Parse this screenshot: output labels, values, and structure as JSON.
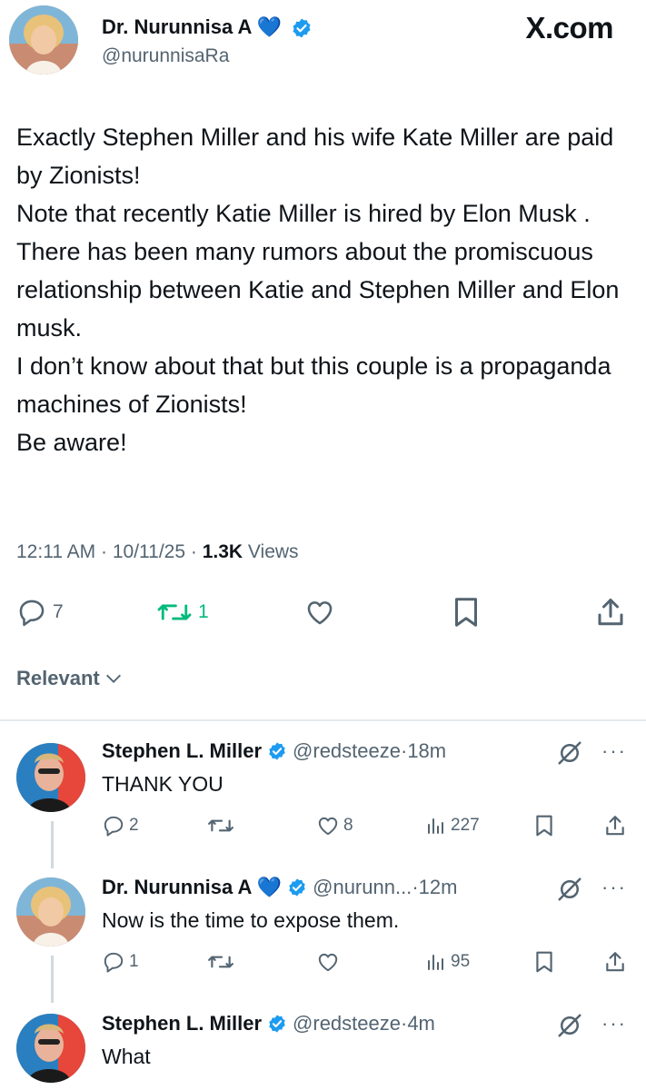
{
  "brand": "X.com",
  "post": {
    "author_name": "Dr. Nurunnisa A 💙",
    "author_handle": "@nurunnisaRa",
    "text": "Exactly Stephen Miller and his wife Kate Miller are paid by Zionists!\nNote that recently Katie Miller is hired by Elon Musk .\nThere has been many rumors about the promiscuous relationship between Katie and Stephen Miller and Elon musk.\nI don’t know about that but this couple is a propaganda machines of Zionists!\nBe aware!",
    "time": "12:11 AM",
    "date": "10/11/25",
    "views_count": "1.3K",
    "views_label": "Views",
    "replies": "7",
    "reposts": "1"
  },
  "sort_label": "Relevant",
  "replies": [
    {
      "name": "Stephen L. Miller",
      "handle": "@redsteeze",
      "age": "18m",
      "text": "THANK YOU",
      "replies": "2",
      "reposts": "",
      "likes": "8",
      "views": "227"
    },
    {
      "name": "Dr. Nurunnisa A 💙",
      "handle": "@nurunn...",
      "age": "12m",
      "text": "Now is the time to expose them.",
      "replies": "1",
      "reposts": "",
      "likes": "",
      "views": "95"
    },
    {
      "name": "Stephen L. Miller",
      "handle": "@redsteeze",
      "age": "4m",
      "text": "What"
    }
  ],
  "colors": {
    "verified": "#1d9bf0",
    "repost_active": "#00ba7c",
    "muted": "#536471"
  },
  "icons": [
    "verified-badge-icon",
    "reply-icon",
    "repost-icon",
    "like-icon",
    "bookmark-icon",
    "share-icon",
    "views-icon",
    "grok-icon",
    "more-icon",
    "chevron-down-icon"
  ]
}
